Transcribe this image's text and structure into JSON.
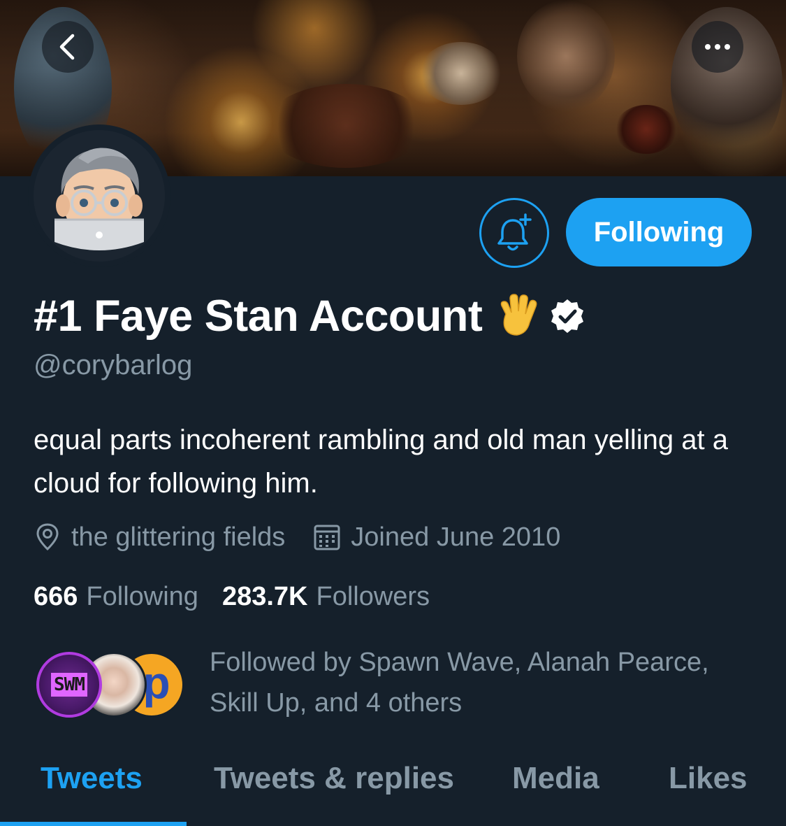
{
  "header": {
    "back_icon": "chevron-left-icon",
    "more_icon": "more-horizontal-icon"
  },
  "profile": {
    "display_name": "#1 Faye Stan Account",
    "name_emoji": "🖖",
    "verified": true,
    "handle": "@corybarlog",
    "bio": "equal parts incoherent rambling and old man yelling at a cloud for following him.",
    "location": "the glittering fields",
    "joined": "Joined June 2010",
    "following_count": "666",
    "following_label": "Following",
    "followers_count": "283.7K",
    "followers_label": "Followers",
    "followed_by_text": "Followed by Spawn Wave, Alanah Pearce, Skill Up, and 4 others",
    "followed_by_avatars": [
      {
        "name": "Spawn Wave",
        "glyph": "SWM"
      },
      {
        "name": "Alanah Pearce"
      },
      {
        "name": "Skill Up",
        "glyph": "p"
      }
    ]
  },
  "actions": {
    "notify_icon": "bell-plus-icon",
    "follow_button_label": "Following"
  },
  "tabs": [
    {
      "label": "Tweets",
      "active": true
    },
    {
      "label": "Tweets & replies",
      "active": false
    },
    {
      "label": "Media",
      "active": false
    },
    {
      "label": "Likes",
      "active": false
    }
  ],
  "colors": {
    "background": "#15202b",
    "accent": "#1da1f2",
    "secondary_text": "#8899a6",
    "primary_text": "#ffffff"
  }
}
